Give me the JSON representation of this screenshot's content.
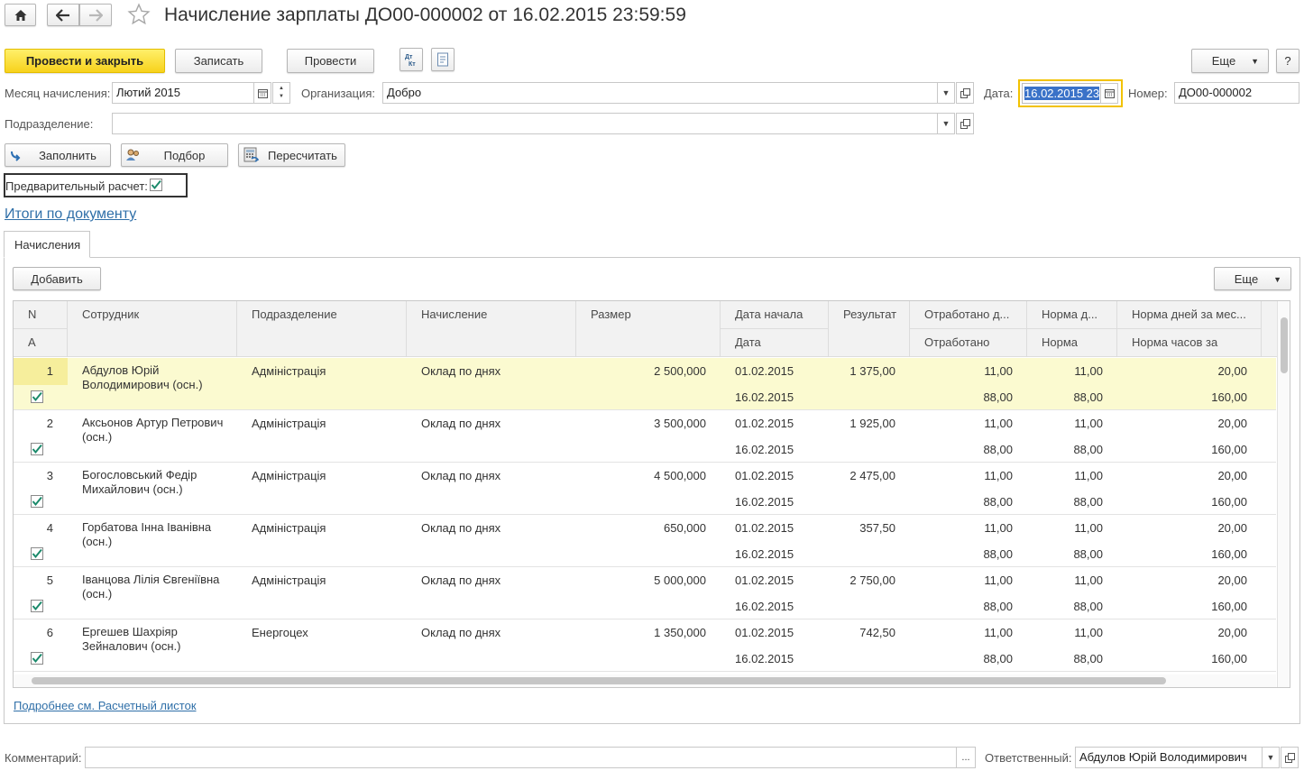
{
  "window": {
    "title": "Начисление зарплаты ДО00-000002 от 16.02.2015 23:59:59",
    "home_icon": "home-icon",
    "back_icon": "arrow-left-icon",
    "forward_icon": "arrow-right-icon",
    "favorite_icon": "star-icon"
  },
  "toolbar": {
    "post_close": "Провести и закрыть",
    "save": "Записать",
    "post": "Провести",
    "more": "Еще",
    "help": "?"
  },
  "form": {
    "month_label": "Месяц начисления:",
    "month_value": "Лютий 2015",
    "org_label": "Организация:",
    "org_value": "Добро",
    "date_label": "Дата:",
    "date_value": "16.02.2015 23",
    "number_label": "Номер:",
    "number_value": "ДО00-000002",
    "dept_label": "Подразделение:",
    "dept_value": ""
  },
  "actions": {
    "fill": "Заполнить",
    "pick": "Подбор",
    "recalc": "Пересчитать"
  },
  "prelim": {
    "label": "Предварительный расчет:",
    "checked": true
  },
  "totals_link": "Итоги по документу",
  "tabs": [
    {
      "label": "Начисления",
      "active": true
    }
  ],
  "table_toolbar": {
    "add": "Добавить",
    "more": "Еще"
  },
  "columns": {
    "n": "N",
    "a": "A",
    "employee": "Сотрудник",
    "dept": "Подразделение",
    "accrual": "Начисление",
    "amount": "Размер",
    "start": "Дата начала",
    "end": "Дата",
    "result": "Результат",
    "worked_days": "Отработано д...",
    "worked": "Отработано",
    "norm_days": "Норма д...",
    "norm": "Норма",
    "norm_month": "Норма дней за мес...",
    "norm_hours": "Норма часов за"
  },
  "rows": [
    {
      "n": "1",
      "employee": "Абдулов Юрій Володимирович (осн.)",
      "dept": "Адміністрація",
      "accrual": "Оклад по днях",
      "amount": "2 500,000",
      "start": "01.02.2015",
      "end": "16.02.2015",
      "result": "1 375,00",
      "worked_days": "11,00",
      "worked_hours": "88,00",
      "norm_days": "11,00",
      "norm_hours": "88,00",
      "month_days": "20,00",
      "month_hours": "160,00",
      "checked": true
    },
    {
      "n": "2",
      "employee": "Аксьонов Артур Петрович (осн.)",
      "dept": "Адміністрація",
      "accrual": "Оклад по днях",
      "amount": "3 500,000",
      "start": "01.02.2015",
      "end": "16.02.2015",
      "result": "1 925,00",
      "worked_days": "11,00",
      "worked_hours": "88,00",
      "norm_days": "11,00",
      "norm_hours": "88,00",
      "month_days": "20,00",
      "month_hours": "160,00",
      "checked": true
    },
    {
      "n": "3",
      "employee": "Богословський Федір Михайлович (осн.)",
      "dept": "Адміністрація",
      "accrual": "Оклад по днях",
      "amount": "4 500,000",
      "start": "01.02.2015",
      "end": "16.02.2015",
      "result": "2 475,00",
      "worked_days": "11,00",
      "worked_hours": "88,00",
      "norm_days": "11,00",
      "norm_hours": "88,00",
      "month_days": "20,00",
      "month_hours": "160,00",
      "checked": true
    },
    {
      "n": "4",
      "employee": "Горбатова Інна Іванівна (осн.)",
      "dept": "Адміністрація",
      "accrual": "Оклад по днях",
      "amount": "650,000",
      "start": "01.02.2015",
      "end": "16.02.2015",
      "result": "357,50",
      "worked_days": "11,00",
      "worked_hours": "88,00",
      "norm_days": "11,00",
      "norm_hours": "88,00",
      "month_days": "20,00",
      "month_hours": "160,00",
      "checked": true
    },
    {
      "n": "5",
      "employee": "Іванцова Лілія Євгеніївна (осн.)",
      "dept": "Адміністрація",
      "accrual": "Оклад по днях",
      "amount": "5 000,000",
      "start": "01.02.2015",
      "end": "16.02.2015",
      "result": "2 750,00",
      "worked_days": "11,00",
      "worked_hours": "88,00",
      "norm_days": "11,00",
      "norm_hours": "88,00",
      "month_days": "20,00",
      "month_hours": "160,00",
      "checked": true
    },
    {
      "n": "6",
      "employee": "Ергешев Шахріяр Зейналович (осн.)",
      "dept": "Енергоцех",
      "accrual": "Оклад по днях",
      "amount": "1 350,000",
      "start": "01.02.2015",
      "end": "16.02.2015",
      "result": "742,50",
      "worked_days": "11,00",
      "worked_hours": "88,00",
      "norm_days": "11,00",
      "norm_hours": "88,00",
      "month_days": "20,00",
      "month_hours": "160,00",
      "checked": true
    }
  ],
  "details_link": "Подробнее см. Расчетный листок",
  "footer": {
    "comment_label": "Комментарий:",
    "comment_value": "",
    "responsible_label": "Ответственный:",
    "responsible_value": "Абдулов Юрій Володимирович"
  },
  "colors": {
    "primary_button": "#f7d21c",
    "selected_row": "#fbfad0",
    "link": "#2f6fa8",
    "date_focus": "#f2c200"
  }
}
